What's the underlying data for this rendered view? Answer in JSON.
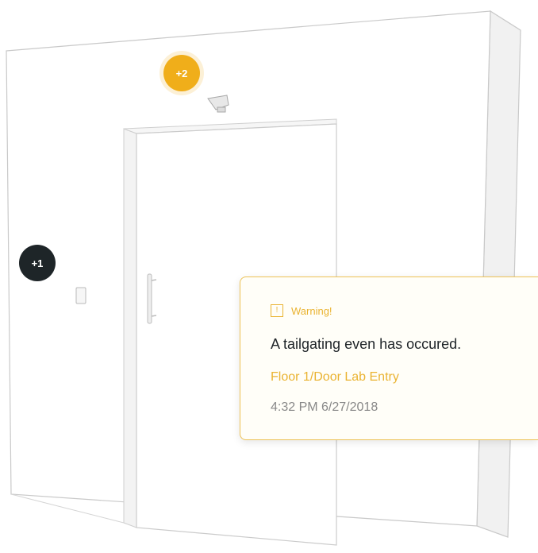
{
  "markers": [
    {
      "label": "+1",
      "color": "#1e2528"
    },
    {
      "label": "+2",
      "color": "#f0ae1a"
    }
  ],
  "alert": {
    "icon": "warning-icon",
    "icon_glyph": "!",
    "title": "Warning!",
    "message": "A tailgating even has occured.",
    "location": "Floor 1/Door Lab Entry",
    "timestamp": "4:32 PM 6/27/2018",
    "accent_color": "#eab331"
  },
  "scene": {
    "icons": [
      "wall",
      "door",
      "door-handle-icon",
      "card-reader-icon",
      "ceiling-sensor-icon"
    ]
  }
}
